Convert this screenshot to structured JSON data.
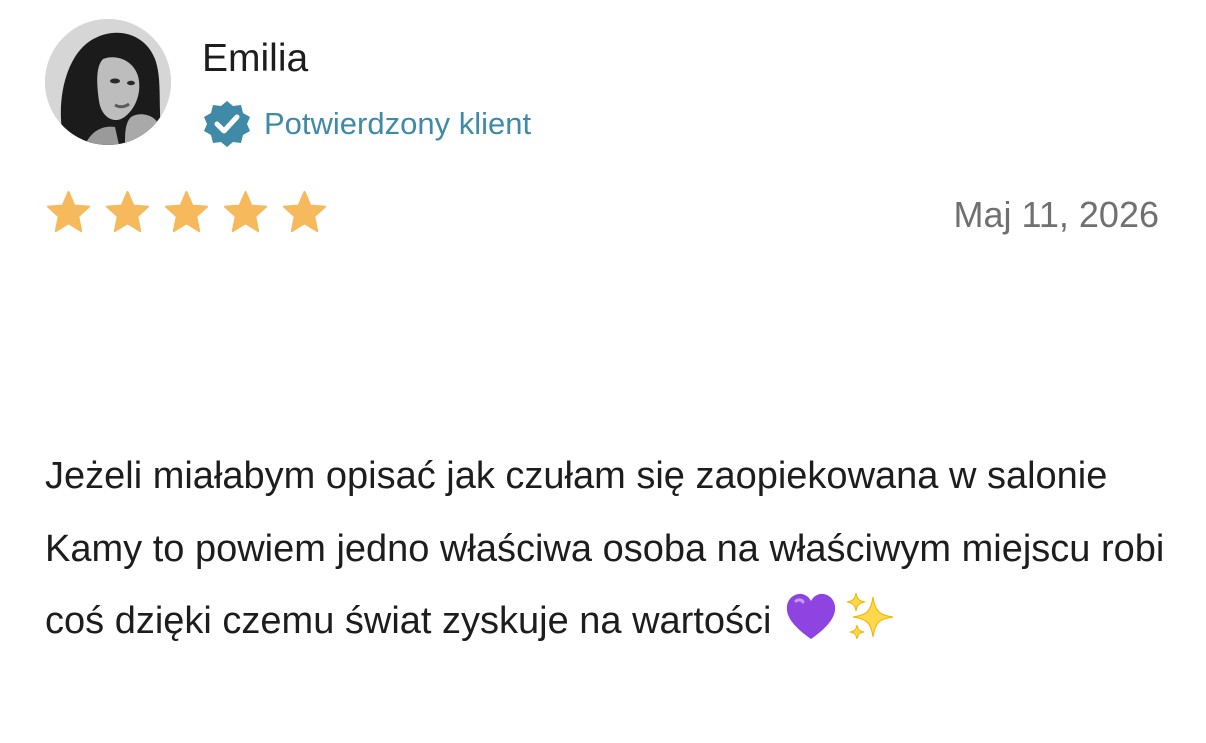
{
  "reviewer": {
    "name": "Emilia",
    "verified_label": "Potwierdzony klient",
    "avatar_icon": "profile-photo"
  },
  "review": {
    "rating": 5,
    "rating_max": 5,
    "date": "Maj 11, 2026",
    "text": "Jeżeli miałabym opisać jak czułam się zaopiekowana w salonie Kamy to powiem jedno właściwa osoba na właściwym miejscu robi coś dzięki czemu świat zyskuje na wartości",
    "emojis": [
      "purple-heart-icon",
      "sparkles-icon"
    ]
  },
  "colors": {
    "accent": "#3f8aa6",
    "star": "#f6b95b",
    "date": "#707070",
    "text": "#1d1d1d"
  }
}
